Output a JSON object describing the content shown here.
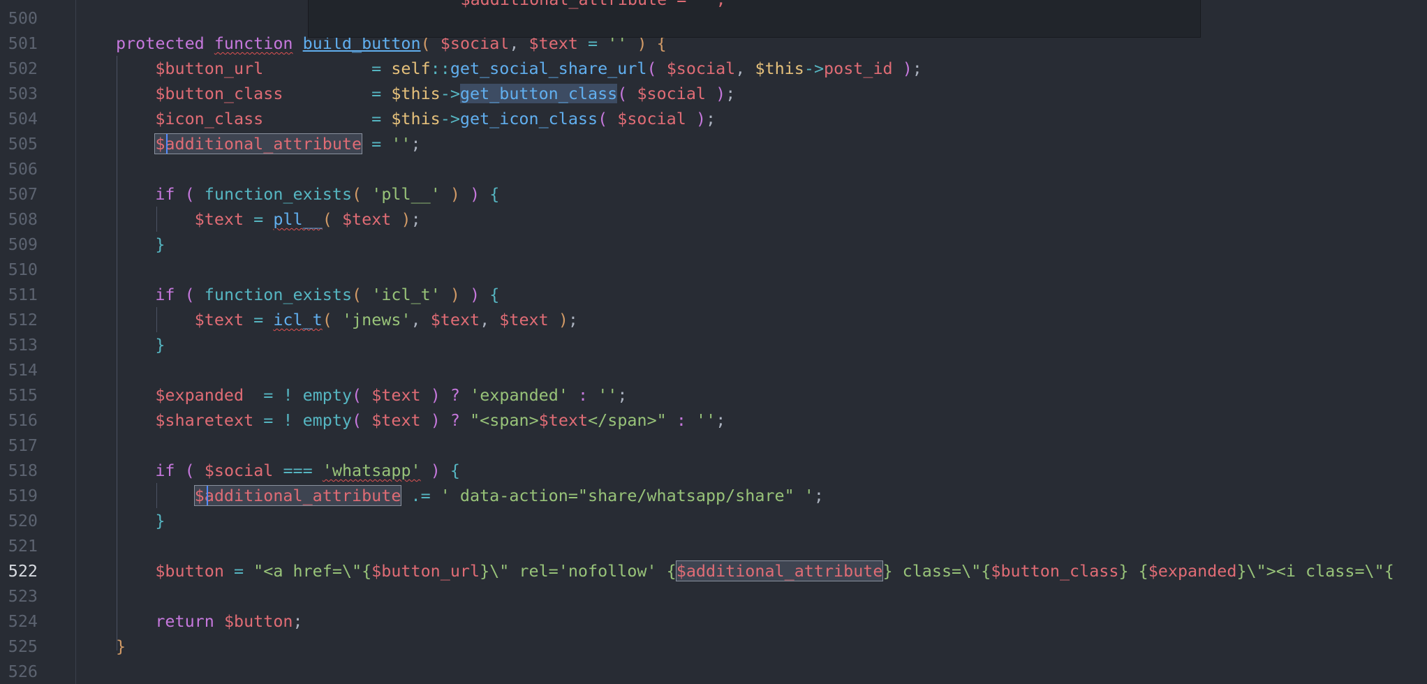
{
  "editor": {
    "active_line": "522",
    "popup_text": "$additional_attribute = '';"
  },
  "lines": [
    {
      "num": "500",
      "parts": []
    },
    {
      "num": "501",
      "parts": [
        {
          "t": "protected ",
          "c": "kw"
        },
        {
          "t": "function",
          "c": "kw squiggle"
        },
        {
          "t": " ",
          "c": "pl"
        },
        {
          "t": "build_button",
          "c": "fn ul"
        },
        {
          "t": "(",
          "c": "p1"
        },
        {
          "t": " ",
          "c": "pl"
        },
        {
          "t": "$social",
          "c": "var"
        },
        {
          "t": ", ",
          "c": "pl"
        },
        {
          "t": "$text",
          "c": "var"
        },
        {
          "t": " = ",
          "c": "op"
        },
        {
          "t": "''",
          "c": "str"
        },
        {
          "t": " ",
          "c": "pl"
        },
        {
          "t": ")",
          "c": "p1"
        },
        {
          "t": " ",
          "c": "pl"
        },
        {
          "t": "{",
          "c": "p1"
        }
      ]
    },
    {
      "num": "502",
      "parts": [
        {
          "t": "    ",
          "c": "pl"
        },
        {
          "t": "$button_url",
          "c": "var"
        },
        {
          "t": "           = ",
          "c": "op"
        },
        {
          "t": "self",
          "c": "cls"
        },
        {
          "t": "::",
          "c": "op"
        },
        {
          "t": "get_social_share_url",
          "c": "fn"
        },
        {
          "t": "(",
          "c": "p2"
        },
        {
          "t": " ",
          "c": "pl"
        },
        {
          "t": "$social",
          "c": "var"
        },
        {
          "t": ", ",
          "c": "pl"
        },
        {
          "t": "$this",
          "c": "cls"
        },
        {
          "t": "->",
          "c": "op"
        },
        {
          "t": "post_id",
          "c": "var"
        },
        {
          "t": " ",
          "c": "pl"
        },
        {
          "t": ")",
          "c": "p2"
        },
        {
          "t": ";",
          "c": "pl"
        }
      ]
    },
    {
      "num": "503",
      "parts": [
        {
          "t": "    ",
          "c": "pl"
        },
        {
          "t": "$button_class",
          "c": "var"
        },
        {
          "t": "         = ",
          "c": "op"
        },
        {
          "t": "$this",
          "c": "cls"
        },
        {
          "t": "->",
          "c": "op"
        },
        {
          "t": "get_button_class",
          "c": "fn sel-hl"
        },
        {
          "t": "(",
          "c": "p2"
        },
        {
          "t": " ",
          "c": "pl"
        },
        {
          "t": "$social",
          "c": "var"
        },
        {
          "t": " ",
          "c": "pl"
        },
        {
          "t": ")",
          "c": "p2"
        },
        {
          "t": ";",
          "c": "pl"
        }
      ]
    },
    {
      "num": "504",
      "parts": [
        {
          "t": "    ",
          "c": "pl"
        },
        {
          "t": "$icon_class",
          "c": "var"
        },
        {
          "t": "           = ",
          "c": "op"
        },
        {
          "t": "$this",
          "c": "cls"
        },
        {
          "t": "->",
          "c": "op"
        },
        {
          "t": "get_icon_class",
          "c": "fn"
        },
        {
          "t": "(",
          "c": "p2"
        },
        {
          "t": " ",
          "c": "pl"
        },
        {
          "t": "$social",
          "c": "var"
        },
        {
          "t": " ",
          "c": "pl"
        },
        {
          "t": ")",
          "c": "p2"
        },
        {
          "t": ";",
          "c": "pl"
        }
      ]
    },
    {
      "num": "505",
      "parts": [
        {
          "t": "    ",
          "c": "pl"
        },
        {
          "t": "$additional_attribute",
          "c": "var box-hl"
        },
        {
          "t": " = ",
          "c": "op"
        },
        {
          "t": "''",
          "c": "str"
        },
        {
          "t": ";",
          "c": "pl"
        }
      ]
    },
    {
      "num": "506",
      "parts": []
    },
    {
      "num": "507",
      "parts": [
        {
          "t": "    ",
          "c": "pl"
        },
        {
          "t": "if",
          "c": "kw"
        },
        {
          "t": " ",
          "c": "pl"
        },
        {
          "t": "(",
          "c": "p2"
        },
        {
          "t": " ",
          "c": "pl"
        },
        {
          "t": "function_exists",
          "c": "op"
        },
        {
          "t": "(",
          "c": "p1"
        },
        {
          "t": " ",
          "c": "pl"
        },
        {
          "t": "'pll__'",
          "c": "str"
        },
        {
          "t": " ",
          "c": "pl"
        },
        {
          "t": ")",
          "c": "p1"
        },
        {
          "t": " ",
          "c": "pl"
        },
        {
          "t": ")",
          "c": "p2"
        },
        {
          "t": " ",
          "c": "pl"
        },
        {
          "t": "{",
          "c": "p3"
        }
      ]
    },
    {
      "num": "508",
      "parts": [
        {
          "t": "        ",
          "c": "pl"
        },
        {
          "t": "$text",
          "c": "var"
        },
        {
          "t": " = ",
          "c": "op"
        },
        {
          "t": "pll__",
          "c": "fn squiggle"
        },
        {
          "t": "(",
          "c": "p1"
        },
        {
          "t": " ",
          "c": "pl"
        },
        {
          "t": "$text",
          "c": "var"
        },
        {
          "t": " ",
          "c": "pl"
        },
        {
          "t": ")",
          "c": "p1"
        },
        {
          "t": ";",
          "c": "pl"
        }
      ]
    },
    {
      "num": "509",
      "parts": [
        {
          "t": "    ",
          "c": "pl"
        },
        {
          "t": "}",
          "c": "p3"
        }
      ]
    },
    {
      "num": "510",
      "parts": []
    },
    {
      "num": "511",
      "parts": [
        {
          "t": "    ",
          "c": "pl"
        },
        {
          "t": "if",
          "c": "kw"
        },
        {
          "t": " ",
          "c": "pl"
        },
        {
          "t": "(",
          "c": "p2"
        },
        {
          "t": " ",
          "c": "pl"
        },
        {
          "t": "function_exists",
          "c": "op"
        },
        {
          "t": "(",
          "c": "p1"
        },
        {
          "t": " ",
          "c": "pl"
        },
        {
          "t": "'icl_t'",
          "c": "str"
        },
        {
          "t": " ",
          "c": "pl"
        },
        {
          "t": ")",
          "c": "p1"
        },
        {
          "t": " ",
          "c": "pl"
        },
        {
          "t": ")",
          "c": "p2"
        },
        {
          "t": " ",
          "c": "pl"
        },
        {
          "t": "{",
          "c": "p3"
        }
      ]
    },
    {
      "num": "512",
      "parts": [
        {
          "t": "        ",
          "c": "pl"
        },
        {
          "t": "$text",
          "c": "var"
        },
        {
          "t": " = ",
          "c": "op"
        },
        {
          "t": "icl_t",
          "c": "fn squiggle"
        },
        {
          "t": "(",
          "c": "p1"
        },
        {
          "t": " ",
          "c": "pl"
        },
        {
          "t": "'jnews'",
          "c": "str"
        },
        {
          "t": ", ",
          "c": "pl"
        },
        {
          "t": "$text",
          "c": "var"
        },
        {
          "t": ", ",
          "c": "pl"
        },
        {
          "t": "$text",
          "c": "var"
        },
        {
          "t": " ",
          "c": "pl"
        },
        {
          "t": ")",
          "c": "p1"
        },
        {
          "t": ";",
          "c": "pl"
        }
      ]
    },
    {
      "num": "513",
      "parts": [
        {
          "t": "    ",
          "c": "pl"
        },
        {
          "t": "}",
          "c": "p3"
        }
      ]
    },
    {
      "num": "514",
      "parts": []
    },
    {
      "num": "515",
      "parts": [
        {
          "t": "    ",
          "c": "pl"
        },
        {
          "t": "$expanded",
          "c": "var"
        },
        {
          "t": "  = ",
          "c": "op"
        },
        {
          "t": "! ",
          "c": "op"
        },
        {
          "t": "empty",
          "c": "op"
        },
        {
          "t": "(",
          "c": "p2"
        },
        {
          "t": " ",
          "c": "pl"
        },
        {
          "t": "$text",
          "c": "var"
        },
        {
          "t": " ",
          "c": "pl"
        },
        {
          "t": ")",
          "c": "p2"
        },
        {
          "t": " ",
          "c": "pl"
        },
        {
          "t": "?",
          "c": "kw"
        },
        {
          "t": " ",
          "c": "pl"
        },
        {
          "t": "'expanded'",
          "c": "str"
        },
        {
          "t": " ",
          "c": "pl"
        },
        {
          "t": ":",
          "c": "kw"
        },
        {
          "t": " ",
          "c": "pl"
        },
        {
          "t": "''",
          "c": "str"
        },
        {
          "t": ";",
          "c": "pl"
        }
      ]
    },
    {
      "num": "516",
      "parts": [
        {
          "t": "    ",
          "c": "pl"
        },
        {
          "t": "$sharetext",
          "c": "var"
        },
        {
          "t": " = ",
          "c": "op"
        },
        {
          "t": "! ",
          "c": "op"
        },
        {
          "t": "empty",
          "c": "op"
        },
        {
          "t": "(",
          "c": "p2"
        },
        {
          "t": " ",
          "c": "pl"
        },
        {
          "t": "$text",
          "c": "var"
        },
        {
          "t": " ",
          "c": "pl"
        },
        {
          "t": ")",
          "c": "p2"
        },
        {
          "t": " ",
          "c": "pl"
        },
        {
          "t": "?",
          "c": "kw"
        },
        {
          "t": " ",
          "c": "pl"
        },
        {
          "t": "\"<span>",
          "c": "str"
        },
        {
          "t": "$text",
          "c": "var"
        },
        {
          "t": "</span>\"",
          "c": "str"
        },
        {
          "t": " ",
          "c": "pl"
        },
        {
          "t": ":",
          "c": "kw"
        },
        {
          "t": " ",
          "c": "pl"
        },
        {
          "t": "''",
          "c": "str"
        },
        {
          "t": ";",
          "c": "pl"
        }
      ]
    },
    {
      "num": "517",
      "parts": []
    },
    {
      "num": "518",
      "parts": [
        {
          "t": "    ",
          "c": "pl"
        },
        {
          "t": "if",
          "c": "kw"
        },
        {
          "t": " ",
          "c": "pl"
        },
        {
          "t": "(",
          "c": "p2"
        },
        {
          "t": " ",
          "c": "pl"
        },
        {
          "t": "$social",
          "c": "var"
        },
        {
          "t": " === ",
          "c": "op"
        },
        {
          "t": "'whatsapp'",
          "c": "str squiggle"
        },
        {
          "t": " ",
          "c": "pl"
        },
        {
          "t": ")",
          "c": "p2"
        },
        {
          "t": " ",
          "c": "pl"
        },
        {
          "t": "{",
          "c": "p3"
        }
      ]
    },
    {
      "num": "519",
      "parts": [
        {
          "t": "        ",
          "c": "pl"
        },
        {
          "t": "$additional_attribute",
          "c": "var box-hl"
        },
        {
          "t": " .= ",
          "c": "op"
        },
        {
          "t": "' data-action=\"share/whatsapp/share\" '",
          "c": "str"
        },
        {
          "t": ";",
          "c": "pl"
        }
      ]
    },
    {
      "num": "520",
      "parts": [
        {
          "t": "    ",
          "c": "pl"
        },
        {
          "t": "}",
          "c": "p3"
        }
      ]
    },
    {
      "num": "521",
      "parts": []
    },
    {
      "num": "522",
      "parts": [
        {
          "t": "    ",
          "c": "pl"
        },
        {
          "t": "$button",
          "c": "var"
        },
        {
          "t": " = ",
          "c": "op"
        },
        {
          "t": "\"<a href=\\\"{",
          "c": "str"
        },
        {
          "t": "$button_url",
          "c": "var"
        },
        {
          "t": "}\\\" rel='nofollow' {",
          "c": "str"
        },
        {
          "t": "$additional_attribute",
          "c": "var box-hl"
        },
        {
          "t": "} class=\\\"{",
          "c": "str"
        },
        {
          "t": "$button_class",
          "c": "var"
        },
        {
          "t": "} {",
          "c": "str"
        },
        {
          "t": "$expanded",
          "c": "var"
        },
        {
          "t": "}\\\"><i class=\\\"{",
          "c": "str"
        }
      ]
    },
    {
      "num": "523",
      "parts": []
    },
    {
      "num": "524",
      "parts": [
        {
          "t": "    ",
          "c": "pl"
        },
        {
          "t": "return",
          "c": "kw"
        },
        {
          "t": " ",
          "c": "pl"
        },
        {
          "t": "$button",
          "c": "var"
        },
        {
          "t": ";",
          "c": "pl"
        }
      ]
    },
    {
      "num": "525",
      "parts": [
        {
          "t": "}",
          "c": "p1"
        }
      ]
    },
    {
      "num": "526",
      "parts": []
    }
  ]
}
